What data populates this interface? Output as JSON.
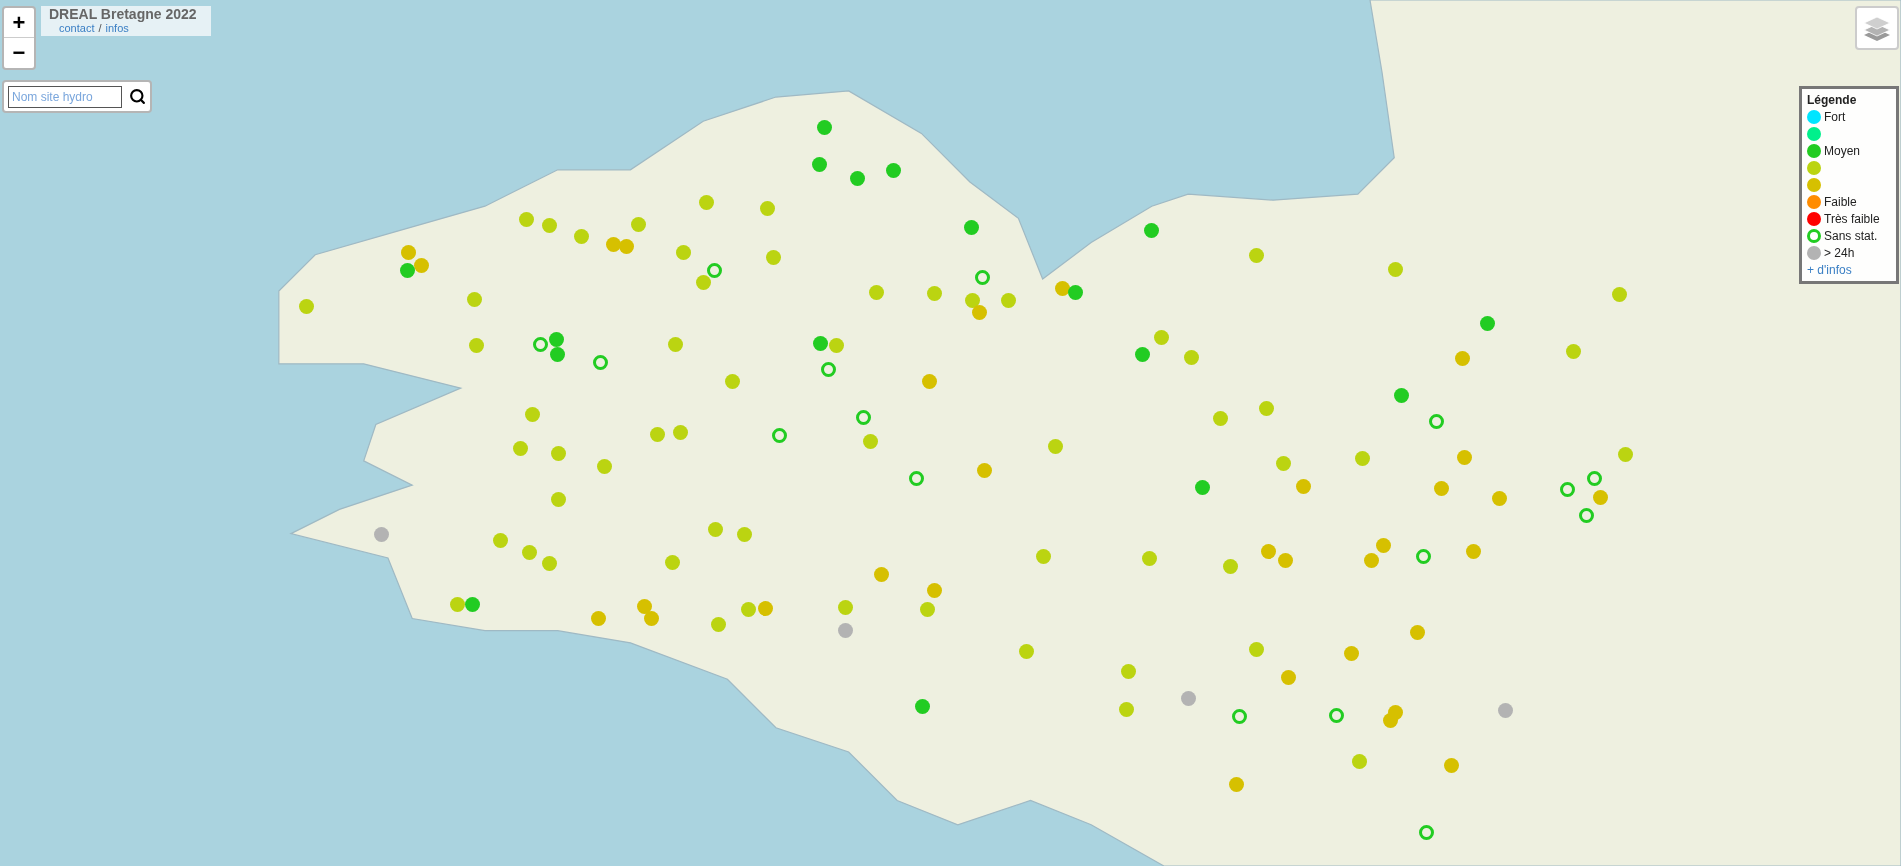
{
  "title_box": {
    "title": "DREAL Bretagne 2022",
    "links": [
      "contact",
      "infos"
    ],
    "separator": "/"
  },
  "zoom": {
    "in": "+",
    "out": "−"
  },
  "search": {
    "placeholder": "Nom site hydro"
  },
  "legend": {
    "title": "Légende",
    "items": [
      {
        "kind": "filled",
        "color": "#00e5ff",
        "label": "Fort"
      },
      {
        "kind": "filled",
        "color": "#00f08c"
      },
      {
        "kind": "filled",
        "color": "#22cc22",
        "label": "Moyen"
      },
      {
        "kind": "filled",
        "color": "#bbd411"
      },
      {
        "kind": "filled",
        "color": "#d6c000"
      },
      {
        "kind": "filled",
        "color": "#ff8c00",
        "label": "Faible"
      },
      {
        "kind": "filled",
        "color": "#ff0000",
        "label": "Très faible"
      },
      {
        "kind": "ring",
        "color": "#22cc22",
        "label": "Sans stat."
      },
      {
        "kind": "filled",
        "color": "#b3b3b3",
        "label": "> 24h"
      }
    ],
    "more_link": "+ d'infos"
  },
  "markers": [
    {
      "kind": "filled",
      "color": "#22cc22"
    },
    {
      "kind": "filled",
      "color": "#22cc22"
    },
    {
      "kind": "filled",
      "color": "#22cc22"
    },
    {
      "kind": "filled",
      "color": "#22cc22"
    },
    {
      "kind": "filled",
      "color": "#bbd411"
    },
    {
      "kind": "filled",
      "color": "#bbd411"
    },
    {
      "kind": "filled",
      "color": "#bbd411"
    },
    {
      "kind": "filled",
      "color": "#bbd411"
    },
    {
      "kind": "filled",
      "color": "#bbd411"
    },
    {
      "kind": "filled",
      "color": "#bbd411"
    },
    {
      "kind": "filled",
      "color": "#d6c000"
    },
    {
      "kind": "filled",
      "color": "#d6c000"
    },
    {
      "kind": "filled",
      "color": "#d6c000"
    },
    {
      "kind": "filled",
      "color": "#d6c000"
    },
    {
      "kind": "filled",
      "color": "#22cc22"
    },
    {
      "kind": "filled",
      "color": "#bbd411"
    },
    {
      "kind": "ring",
      "color": "#22cc22"
    },
    {
      "kind": "filled",
      "color": "#bbd411"
    },
    {
      "kind": "filled",
      "color": "#bbd411"
    },
    {
      "kind": "filled",
      "color": "#22cc22"
    },
    {
      "kind": "filled",
      "color": "#22cc22"
    },
    {
      "kind": "filled",
      "color": "#bbd411"
    },
    {
      "kind": "filled",
      "color": "#bbd411"
    },
    {
      "kind": "filled",
      "color": "#bbd411"
    },
    {
      "kind": "filled",
      "color": "#bbd411"
    },
    {
      "kind": "filled",
      "color": "#bbd411"
    },
    {
      "kind": "filled",
      "color": "#bbd411"
    },
    {
      "kind": "filled",
      "color": "#bbd411"
    },
    {
      "kind": "ring",
      "color": "#22cc22"
    },
    {
      "kind": "filled",
      "color": "#bbd411"
    },
    {
      "kind": "filled",
      "color": "#d6c000"
    },
    {
      "kind": "filled",
      "color": "#22cc22"
    },
    {
      "kind": "filled",
      "color": "#bbd411"
    },
    {
      "kind": "filled",
      "color": "#d6c000"
    },
    {
      "kind": "filled",
      "color": "#22cc22"
    },
    {
      "kind": "ring",
      "color": "#22cc22"
    },
    {
      "kind": "filled",
      "color": "#22cc22"
    },
    {
      "kind": "filled",
      "color": "#22cc22"
    },
    {
      "kind": "ring",
      "color": "#22cc22"
    },
    {
      "kind": "filled",
      "color": "#bbd411"
    },
    {
      "kind": "filled",
      "color": "#bbd411"
    },
    {
      "kind": "filled",
      "color": "#22cc22"
    },
    {
      "kind": "filled",
      "color": "#bbd411"
    },
    {
      "kind": "ring",
      "color": "#22cc22"
    },
    {
      "kind": "filled",
      "color": "#bbd411"
    },
    {
      "kind": "filled",
      "color": "#22cc22"
    },
    {
      "kind": "filled",
      "color": "#bbd411"
    },
    {
      "kind": "filled",
      "color": "#bbd411"
    },
    {
      "kind": "filled",
      "color": "#d6c000"
    },
    {
      "kind": "filled",
      "color": "#bbd411"
    },
    {
      "kind": "filled",
      "color": "#d6c000"
    },
    {
      "kind": "filled",
      "color": "#22cc22"
    },
    {
      "kind": "filled",
      "color": "#bbd411"
    },
    {
      "kind": "filled",
      "color": "#bbd411"
    },
    {
      "kind": "filled",
      "color": "#bbd411"
    },
    {
      "kind": "ring",
      "color": "#22cc22"
    },
    {
      "kind": "ring",
      "color": "#22cc22"
    },
    {
      "kind": "filled",
      "color": "#bbd411"
    },
    {
      "kind": "filled",
      "color": "#bbd411"
    },
    {
      "kind": "ring",
      "color": "#22cc22"
    },
    {
      "kind": "filled",
      "color": "#bbd411"
    },
    {
      "kind": "filled",
      "color": "#bbd411"
    },
    {
      "kind": "filled",
      "color": "#bbd411"
    },
    {
      "kind": "filled",
      "color": "#bbd411"
    },
    {
      "kind": "filled",
      "color": "#bbd411"
    },
    {
      "kind": "filled",
      "color": "#bbd411"
    },
    {
      "kind": "filled",
      "color": "#d6c000"
    },
    {
      "kind": "filled",
      "color": "#bbd411"
    },
    {
      "kind": "filled",
      "color": "#d6c000"
    },
    {
      "kind": "ring",
      "color": "#22cc22"
    },
    {
      "kind": "filled",
      "color": "#bbd411"
    },
    {
      "kind": "ring",
      "color": "#22cc22"
    },
    {
      "kind": "filled",
      "color": "#d6c000"
    },
    {
      "kind": "filled",
      "color": "#22cc22"
    },
    {
      "kind": "filled",
      "color": "#d6c000"
    },
    {
      "kind": "ring",
      "color": "#22cc22"
    },
    {
      "kind": "filled",
      "color": "#d6c000"
    },
    {
      "kind": "filled",
      "color": "#d6c000"
    },
    {
      "kind": "filled",
      "color": "#bbd411"
    },
    {
      "kind": "ring",
      "color": "#22cc22"
    },
    {
      "kind": "filled",
      "color": "#b3b3b3"
    },
    {
      "kind": "filled",
      "color": "#bbd411"
    },
    {
      "kind": "filled",
      "color": "#bbd411"
    },
    {
      "kind": "filled",
      "color": "#bbd411"
    },
    {
      "kind": "filled",
      "color": "#bbd411"
    },
    {
      "kind": "filled",
      "color": "#bbd411"
    },
    {
      "kind": "filled",
      "color": "#d6c000"
    },
    {
      "kind": "filled",
      "color": "#d6c000"
    },
    {
      "kind": "filled",
      "color": "#d6c000"
    },
    {
      "kind": "filled",
      "color": "#d6c000"
    },
    {
      "kind": "ring",
      "color": "#22cc22"
    },
    {
      "kind": "filled",
      "color": "#d6c000"
    },
    {
      "kind": "filled",
      "color": "#bbd411"
    },
    {
      "kind": "filled",
      "color": "#bbd411"
    },
    {
      "kind": "filled",
      "color": "#bbd411"
    },
    {
      "kind": "filled",
      "color": "#bbd411"
    },
    {
      "kind": "filled",
      "color": "#d6c000"
    },
    {
      "kind": "filled",
      "color": "#d6c000"
    },
    {
      "kind": "filled",
      "color": "#bbd411"
    },
    {
      "kind": "filled",
      "color": "#22cc22"
    },
    {
      "kind": "filled",
      "color": "#d6c000"
    },
    {
      "kind": "filled",
      "color": "#d6c000"
    },
    {
      "kind": "filled",
      "color": "#d6c000"
    },
    {
      "kind": "filled",
      "color": "#bbd411"
    },
    {
      "kind": "filled",
      "color": "#d6c000"
    },
    {
      "kind": "filled",
      "color": "#bbd411"
    },
    {
      "kind": "filled",
      "color": "#bbd411"
    },
    {
      "kind": "filled",
      "color": "#bbd411"
    },
    {
      "kind": "filled",
      "color": "#b3b3b3"
    },
    {
      "kind": "filled",
      "color": "#d6c000"
    },
    {
      "kind": "filled",
      "color": "#bbd411"
    },
    {
      "kind": "filled",
      "color": "#bbd411"
    },
    {
      "kind": "filled",
      "color": "#d6c000"
    },
    {
      "kind": "filled",
      "color": "#bbd411"
    },
    {
      "kind": "filled",
      "color": "#d6c000"
    },
    {
      "kind": "filled",
      "color": "#bbd411"
    },
    {
      "kind": "filled",
      "color": "#b3b3b3"
    },
    {
      "kind": "filled",
      "color": "#22cc22"
    },
    {
      "kind": "ring",
      "color": "#22cc22"
    },
    {
      "kind": "ring",
      "color": "#22cc22"
    },
    {
      "kind": "filled",
      "color": "#d6c000"
    },
    {
      "kind": "filled",
      "color": "#d6c000"
    },
    {
      "kind": "filled",
      "color": "#b3b3b3"
    },
    {
      "kind": "filled",
      "color": "#bbd411"
    },
    {
      "kind": "filled",
      "color": "#d6c000"
    },
    {
      "kind": "filled",
      "color": "#d6c000"
    },
    {
      "kind": "ring",
      "color": "#22cc22"
    }
  ]
}
